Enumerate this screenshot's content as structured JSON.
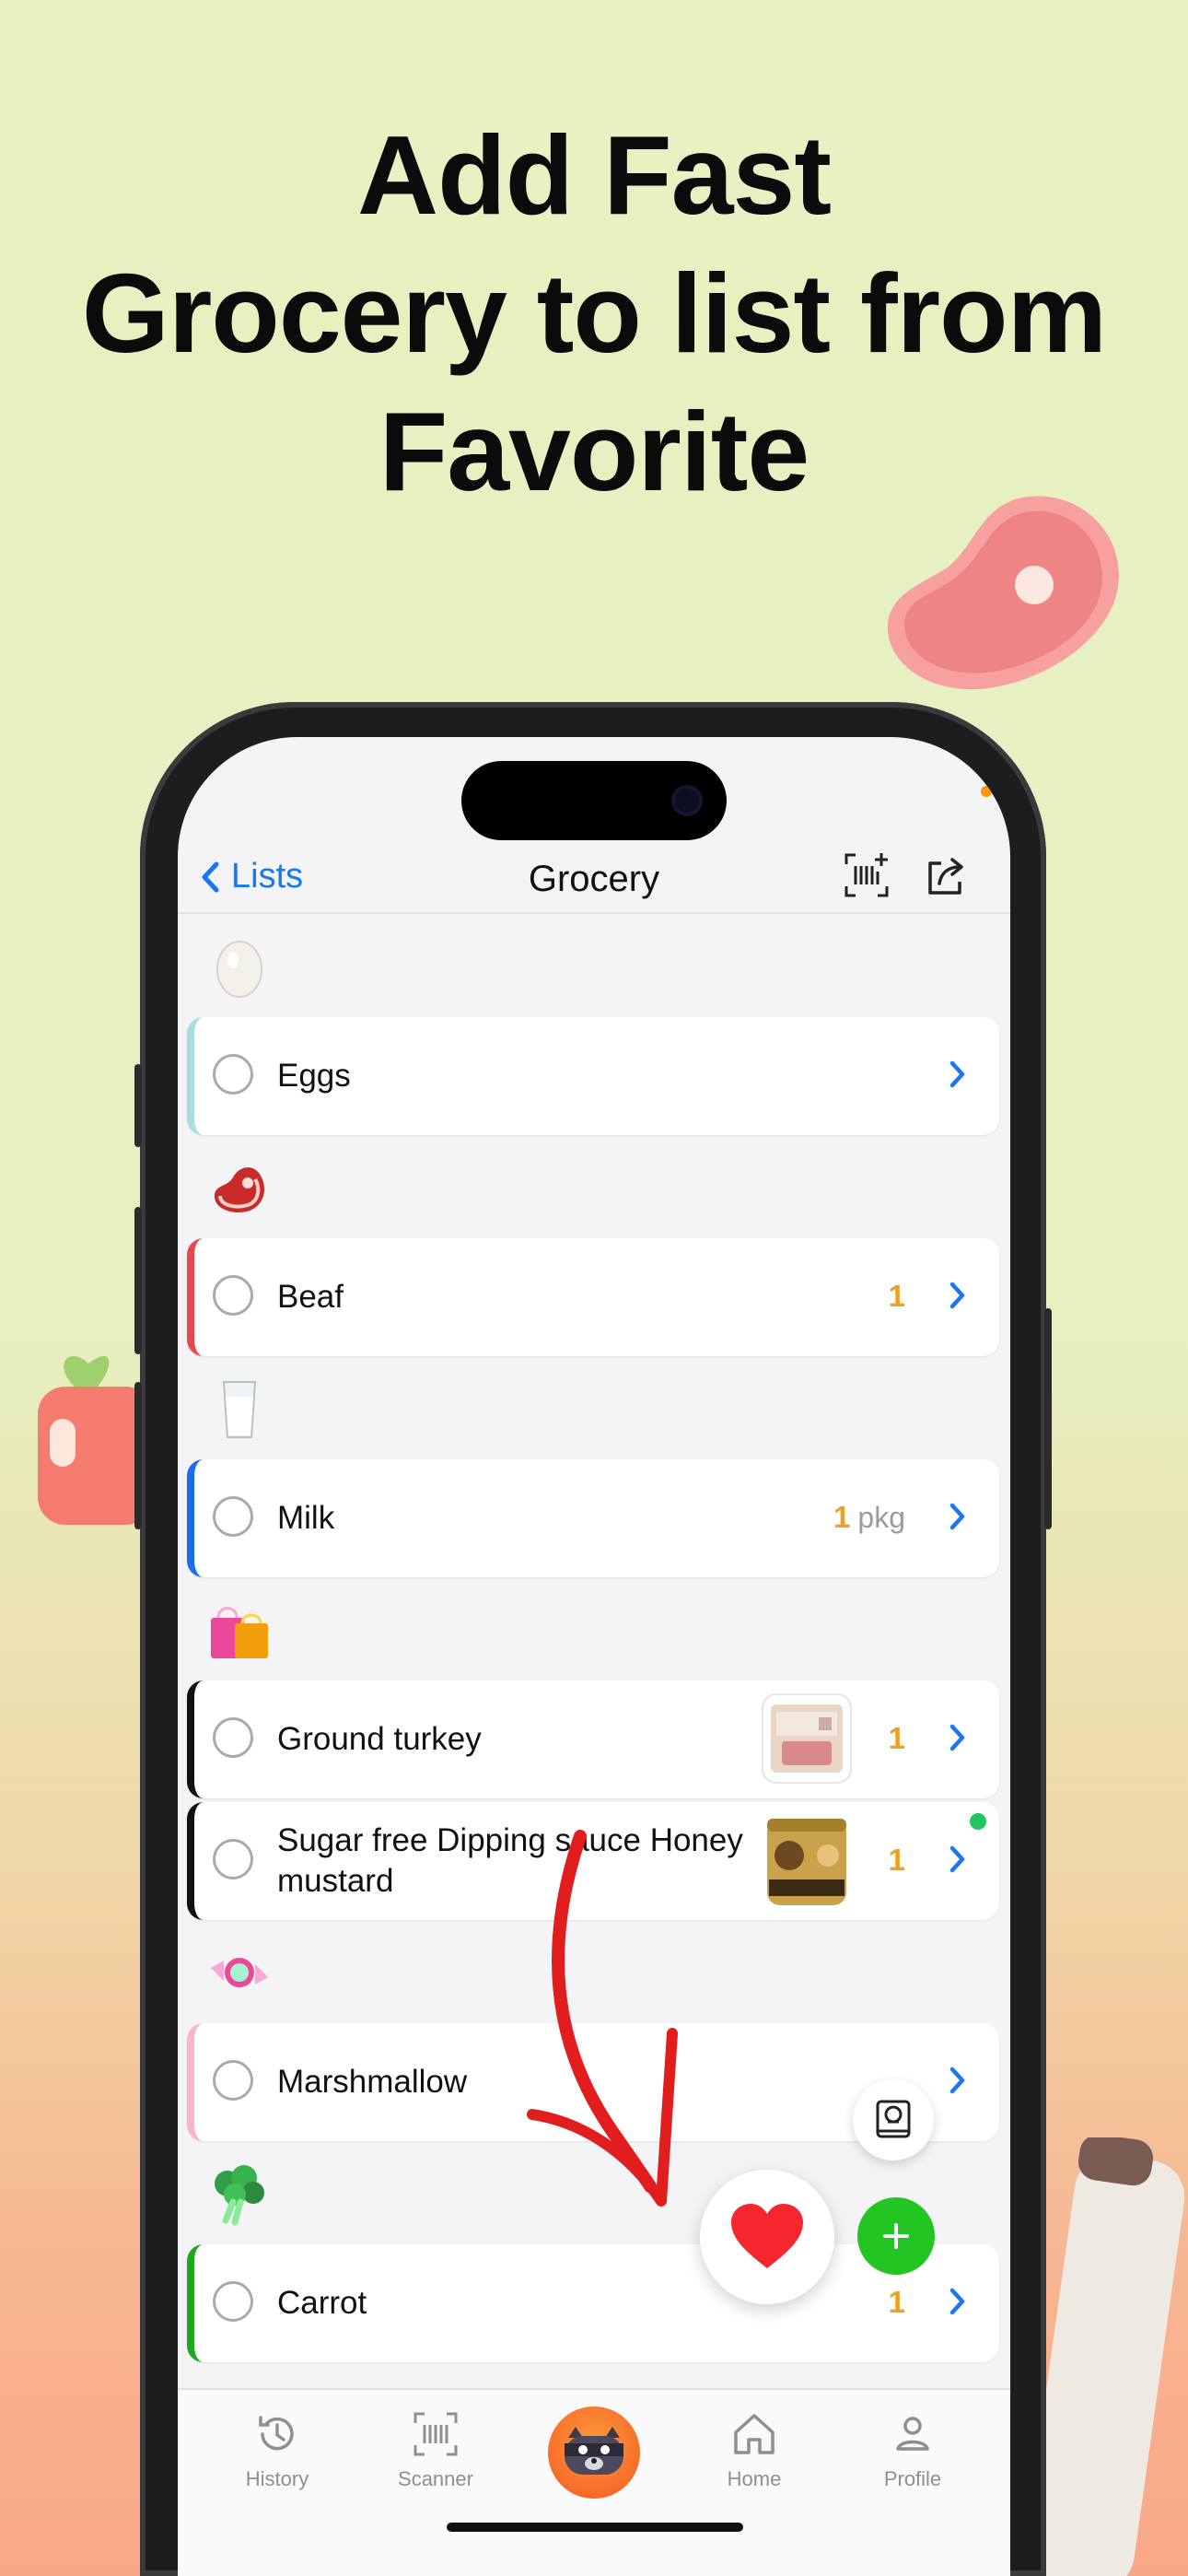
{
  "headline": [
    "Add Fast",
    "Grocery to list from",
    "Favorite"
  ],
  "navbar": {
    "back_label": "Lists",
    "title": "Grocery"
  },
  "sections": [
    {
      "emoji_icon": "egg-icon",
      "items": [
        {
          "label": "Eggs",
          "accent": "#a9dde4",
          "qty": "",
          "unit": ""
        }
      ]
    },
    {
      "emoji_icon": "meat-icon",
      "items": [
        {
          "label": "Beaf",
          "accent": "#e5484d",
          "qty": "1",
          "unit": ""
        }
      ]
    },
    {
      "emoji_icon": "milk-icon",
      "items": [
        {
          "label": "Milk",
          "accent": "#1a6fe8",
          "qty": "1",
          "unit": "pkg"
        }
      ]
    },
    {
      "emoji_icon": "shopping-bags-icon",
      "items": [
        {
          "label": "Ground turkey",
          "accent": "#111111",
          "qty": "1",
          "unit": "",
          "thumb": "product-thumb-turkey"
        },
        {
          "label": "Sugar free Dipping sauce Honey mustard",
          "accent": "#111111",
          "qty": "1",
          "unit": "",
          "thumb": "product-thumb-sauce"
        }
      ]
    },
    {
      "emoji_icon": "candy-icon",
      "items": [
        {
          "label": "Marshmallow",
          "accent": "#f7b6cc",
          "qty": "",
          "unit": ""
        }
      ]
    },
    {
      "emoji_icon": "broccoli-icon",
      "items": [
        {
          "label": "Carrot",
          "accent": "#1fa81f",
          "qty": "1",
          "unit": ""
        }
      ]
    }
  ],
  "tabbar": {
    "history": "History",
    "scanner": "Scanner",
    "home": "Home",
    "profile": "Profile"
  },
  "colors": {
    "accent_blue": "#1877f2",
    "qty_orange": "#f0a020",
    "fab_green": "#22c522",
    "heart_red": "#f4262e"
  }
}
